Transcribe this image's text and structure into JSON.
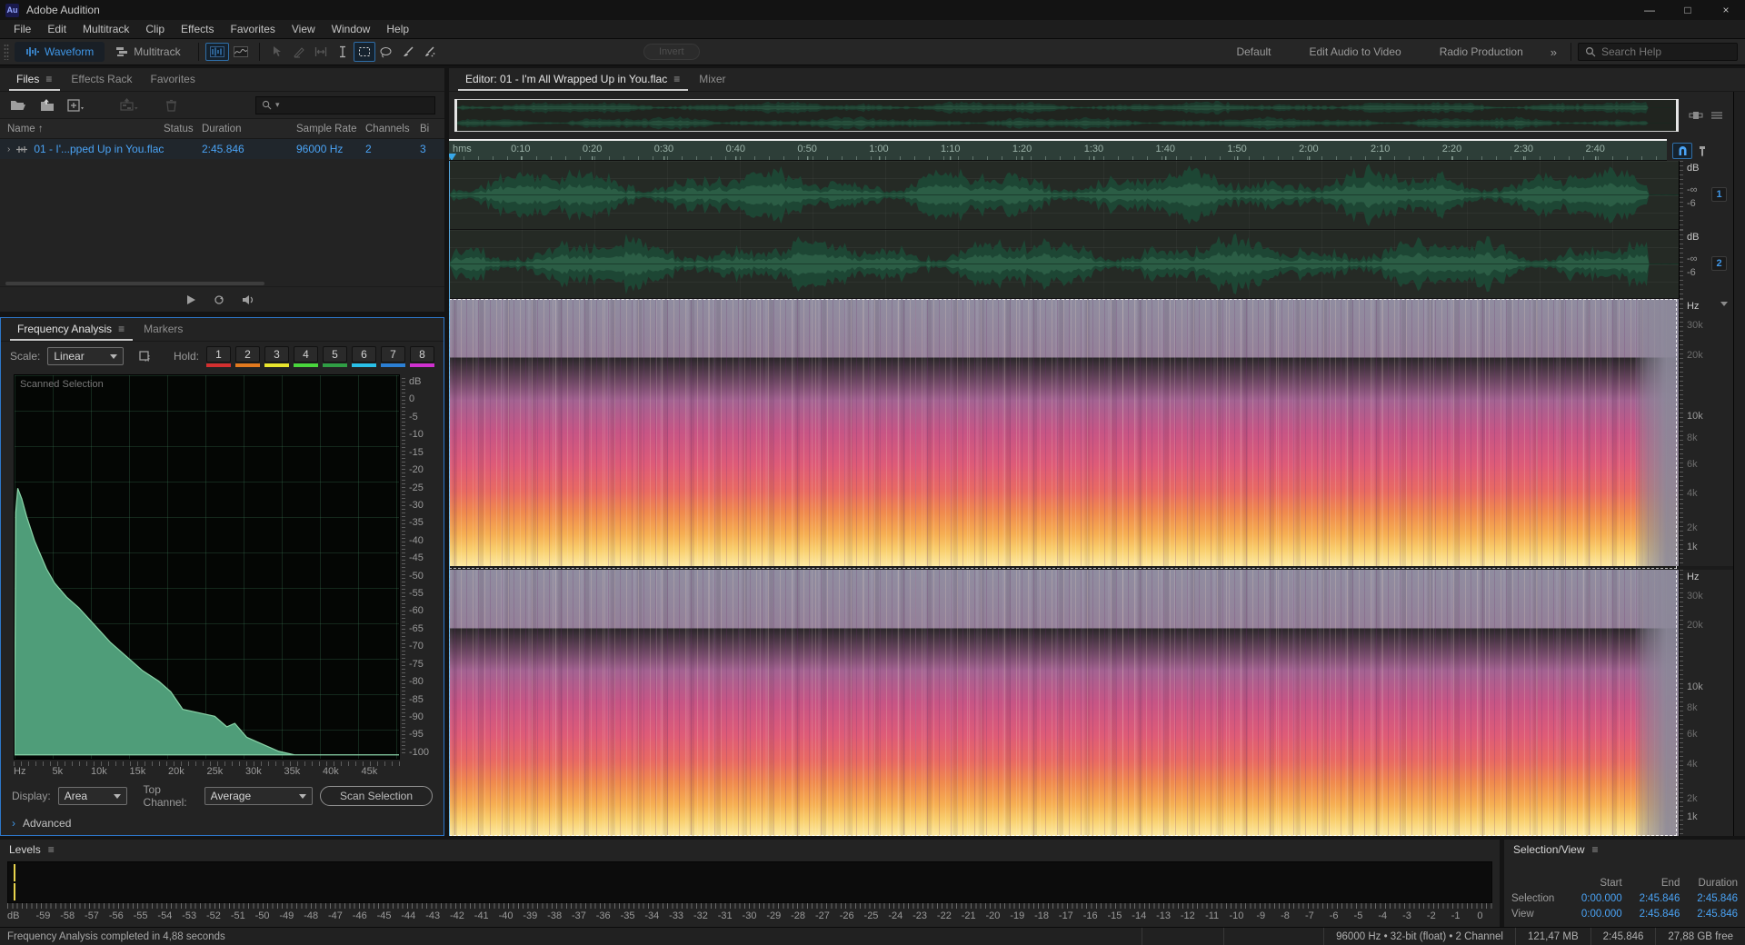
{
  "titlebar": {
    "logo": "Au",
    "title": "Adobe Audition",
    "controls": {
      "minimize": "—",
      "maximize": "□",
      "close": "×"
    }
  },
  "menubar": {
    "items": [
      "File",
      "Edit",
      "Multitrack",
      "Clip",
      "Effects",
      "Favorites",
      "View",
      "Window",
      "Help"
    ]
  },
  "toolbar": {
    "waveform": "Waveform",
    "multitrack": "Multitrack",
    "invert": "Invert",
    "workspaces": [
      "Default",
      "Edit Audio to Video",
      "Radio Production"
    ],
    "more": "»",
    "search_placeholder": "Search Help"
  },
  "files_panel": {
    "tabs": [
      "Files",
      "Effects Rack",
      "Favorites"
    ],
    "sort_indicator": "↑",
    "columns": [
      "Name",
      "Status",
      "Duration",
      "Sample Rate",
      "Channels",
      "Bi"
    ],
    "row": {
      "name": "01 - I'...pped Up in You.flac",
      "status": "",
      "duration": "2:45.846",
      "sample_rate": "96000 Hz",
      "channels": "2",
      "bit": "3"
    }
  },
  "frequency_panel": {
    "tabs": [
      "Frequency Analysis",
      "Markers"
    ],
    "scale_label": "Scale:",
    "scale_value": "Linear",
    "hold_label": "Hold:",
    "holds": [
      {
        "label": "1",
        "color": "#d32f2f"
      },
      {
        "label": "2",
        "color": "#e2791e"
      },
      {
        "label": "3",
        "color": "#e8e52d"
      },
      {
        "label": "4",
        "color": "#49d63c"
      },
      {
        "label": "5",
        "color": "#2f9e44"
      },
      {
        "label": "6",
        "color": "#29c0e8"
      },
      {
        "label": "7",
        "color": "#2b7fd4"
      },
      {
        "label": "8",
        "color": "#cf30cf"
      }
    ],
    "overlay_text": "Scanned Selection",
    "db_axis_title": "dB",
    "db_ticks": [
      "0",
      "-5",
      "-10",
      "-15",
      "-20",
      "-25",
      "-30",
      "-35",
      "-40",
      "-45",
      "-50",
      "-55",
      "-60",
      "-65",
      "-70",
      "-75",
      "-80",
      "-85",
      "-90",
      "-95",
      "-100"
    ],
    "freq_ticks": [
      "Hz",
      "5k",
      "10k",
      "15k",
      "20k",
      "25k",
      "30k",
      "35k",
      "40k",
      "45k"
    ],
    "curve": {
      "freq_max_hz": 48000,
      "db_top": 0,
      "db_bottom": -100,
      "points": [
        [
          0,
          -100
        ],
        [
          150,
          -31
        ],
        [
          400,
          -24
        ],
        [
          900,
          -27
        ],
        [
          1500,
          -32
        ],
        [
          2500,
          -39
        ],
        [
          4000,
          -47
        ],
        [
          5000,
          -51
        ],
        [
          6500,
          -55
        ],
        [
          8000,
          -58
        ],
        [
          10000,
          -63
        ],
        [
          12000,
          -68
        ],
        [
          14000,
          -72
        ],
        [
          16000,
          -76
        ],
        [
          18000,
          -79
        ],
        [
          19500,
          -82
        ],
        [
          21000,
          -87
        ],
        [
          23000,
          -88
        ],
        [
          25000,
          -89
        ],
        [
          26500,
          -92
        ],
        [
          27500,
          -91
        ],
        [
          29000,
          -95
        ],
        [
          31000,
          -97
        ],
        [
          33000,
          -99
        ],
        [
          35000,
          -100
        ],
        [
          48000,
          -100
        ]
      ]
    },
    "display_label": "Display:",
    "display_value": "Area",
    "top_channel_label": "Top Channel:",
    "top_channel_value": "Average",
    "scan_button": "Scan Selection",
    "advanced_label": "Advanced"
  },
  "editor": {
    "tab_editor": "Editor: 01 - I'm All Wrapped Up in You.flac",
    "tab_mixer": "Mixer",
    "ruler_unit": "hms",
    "time_ticks": [
      "0:10",
      "0:20",
      "0:30",
      "0:40",
      "0:50",
      "1:00",
      "1:10",
      "1:20",
      "1:30",
      "1:40",
      "1:50",
      "2:00",
      "2:10",
      "2:20",
      "2:30",
      "2:40"
    ],
    "wave_rail": {
      "title": "dB",
      "ticks": [
        "-∞",
        "-6"
      ]
    },
    "channels": [
      "1",
      "2"
    ],
    "spec_rail": {
      "title": "Hz",
      "ticks": [
        "30k",
        "20k",
        "10k",
        "8k",
        "6k",
        "4k",
        "2k",
        "1k"
      ],
      "bright": [
        "10k",
        "1k"
      ]
    }
  },
  "levels": {
    "title": "Levels",
    "unit": "dB",
    "ticks": [
      "-59",
      "-58",
      "-57",
      "-56",
      "-55",
      "-54",
      "-53",
      "-52",
      "-51",
      "-50",
      "-49",
      "-48",
      "-47",
      "-46",
      "-45",
      "-44",
      "-43",
      "-42",
      "-41",
      "-40",
      "-39",
      "-38",
      "-37",
      "-36",
      "-35",
      "-34",
      "-33",
      "-32",
      "-31",
      "-30",
      "-29",
      "-28",
      "-27",
      "-26",
      "-25",
      "-24",
      "-23",
      "-22",
      "-21",
      "-20",
      "-19",
      "-18",
      "-17",
      "-16",
      "-15",
      "-14",
      "-13",
      "-12",
      "-11",
      "-10",
      "-9",
      "-8",
      "-7",
      "-6",
      "-5",
      "-4",
      "-3",
      "-2",
      "-1",
      "0"
    ]
  },
  "selection_view": {
    "title": "Selection/View",
    "columns": [
      "Start",
      "End",
      "Duration"
    ],
    "rows": [
      {
        "label": "Selection",
        "start": "0:00.000",
        "end": "2:45.846",
        "duration": "2:45.846"
      },
      {
        "label": "View",
        "start": "0:00.000",
        "end": "2:45.846",
        "duration": "2:45.846"
      }
    ]
  },
  "statusbar": {
    "left": "Frequency Analysis completed in 4,88 seconds",
    "segments": [
      "96000 Hz • 32-bit (float) • 2 Channel",
      "121,47 MB",
      "2:45.846",
      "27,88 GB free"
    ]
  }
}
